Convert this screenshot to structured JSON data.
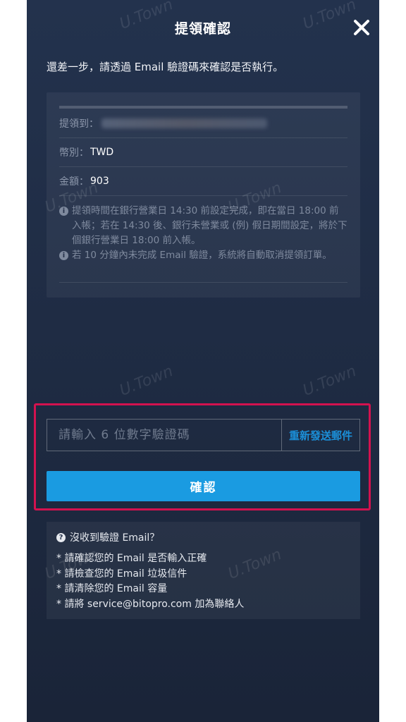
{
  "header": {
    "title": "提領確認",
    "close_icon": "close-icon"
  },
  "subtitle": "還差一步，請透過 Email 驗證碼來確認是否執行。",
  "details": {
    "to_label": "提領到：",
    "currency_label": "幣別：",
    "currency_value": "TWD",
    "amount_label": "金額：",
    "amount_value": "903",
    "notes": [
      "提領時間在銀行營業日 14:30 前設定完成，即在當日 18:00 前入帳；若在 14:30 後、銀行未營業或 (例) 假日期間設定，將於下個銀行營業日 18:00 前入帳。",
      "若 10 分鐘內未完成 Email 驗證，系統將自動取消提領訂單。"
    ]
  },
  "verification": {
    "placeholder": "請輸入 6 位數字驗證碼",
    "resend_label": "重新發送郵件",
    "confirm_label": "確認"
  },
  "help": {
    "question": "沒收到驗證 Email？",
    "tips": [
      "* 請確認您的 Email 是否輸入正確",
      "* 請檢查您的 Email 垃圾信件",
      "* 請清除您的 Email 容量",
      "* 請將 service@bitopro.com 加為聯絡人"
    ]
  },
  "watermark": "U.Town",
  "colors": {
    "accent": "#1a9be1",
    "highlight": "#d3124f",
    "panel": "#1f2c44"
  }
}
